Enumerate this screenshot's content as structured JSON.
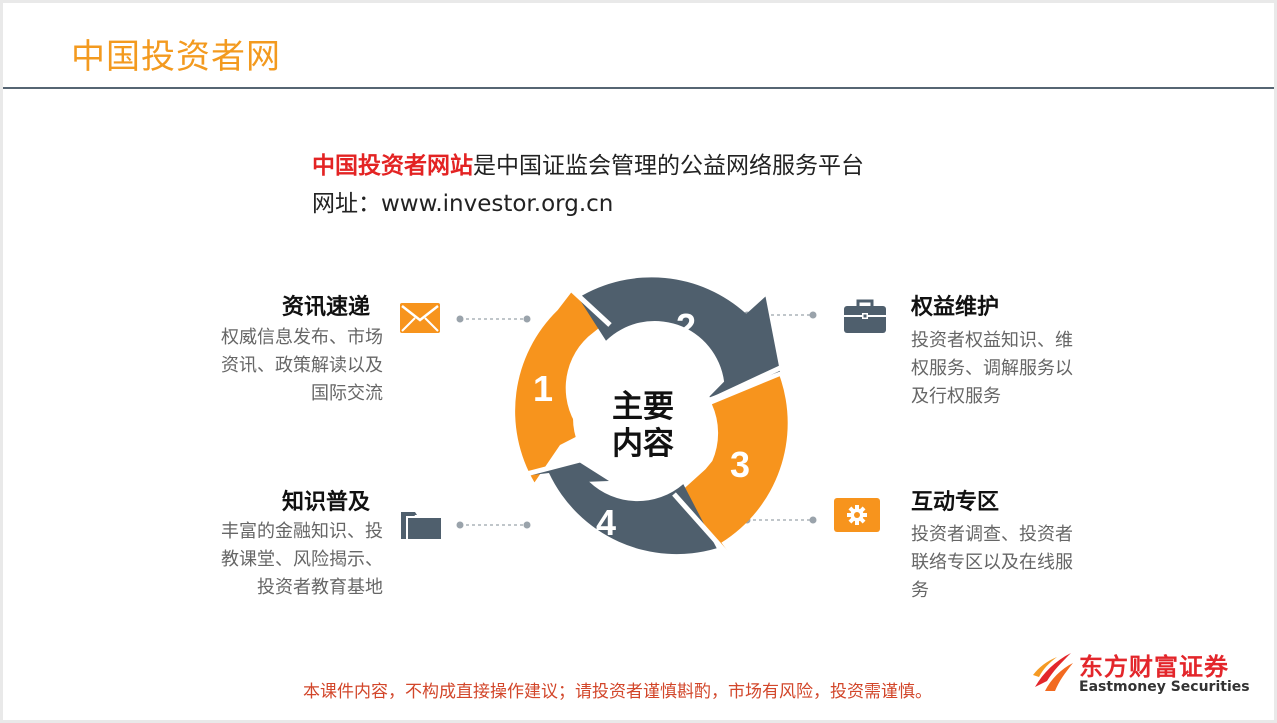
{
  "header": {
    "title": "中国投资者网"
  },
  "intro": {
    "highlight": "中国投资者网站",
    "rest": "是中国证监会管理的公益网络服务平台",
    "url_line": "网址：www.investor.org.cn"
  },
  "center": {
    "line1": "主要",
    "line2": "内容"
  },
  "steps": [
    "1",
    "2",
    "3",
    "4"
  ],
  "items": [
    {
      "title": "资讯速递",
      "lines": [
        "权威信息发布、市场",
        "资讯、政策解读以及",
        "国际交流"
      ],
      "icon": "envelope-icon"
    },
    {
      "title": "知识普及",
      "lines": [
        "丰富的金融知识、投",
        "教课堂、风险揭示、",
        "投资者教育基地"
      ],
      "icon": "folder-icon"
    },
    {
      "title": "权益维护",
      "lines": [
        "投资者权益知识、维",
        "权服务、调解服务以",
        "及行权服务"
      ],
      "icon": "briefcase-icon"
    },
    {
      "title": "互动专区",
      "lines": [
        "投资者调查、投资者",
        "联络专区以及在线服",
        "务"
      ],
      "icon": "gear-icon"
    }
  ],
  "footer": {
    "disclaimer": "本课件内容，不构成直接操作建议；请投资者谨慎斟酌，市场有风险，投资需谨慎。",
    "logo_cn": "东方财富证券",
    "logo_en": "Eastmoney Securities"
  },
  "colors": {
    "orange": "#f7941d",
    "slate": "#4f5f6d",
    "title": "#f39a1f",
    "red": "#e32323"
  }
}
